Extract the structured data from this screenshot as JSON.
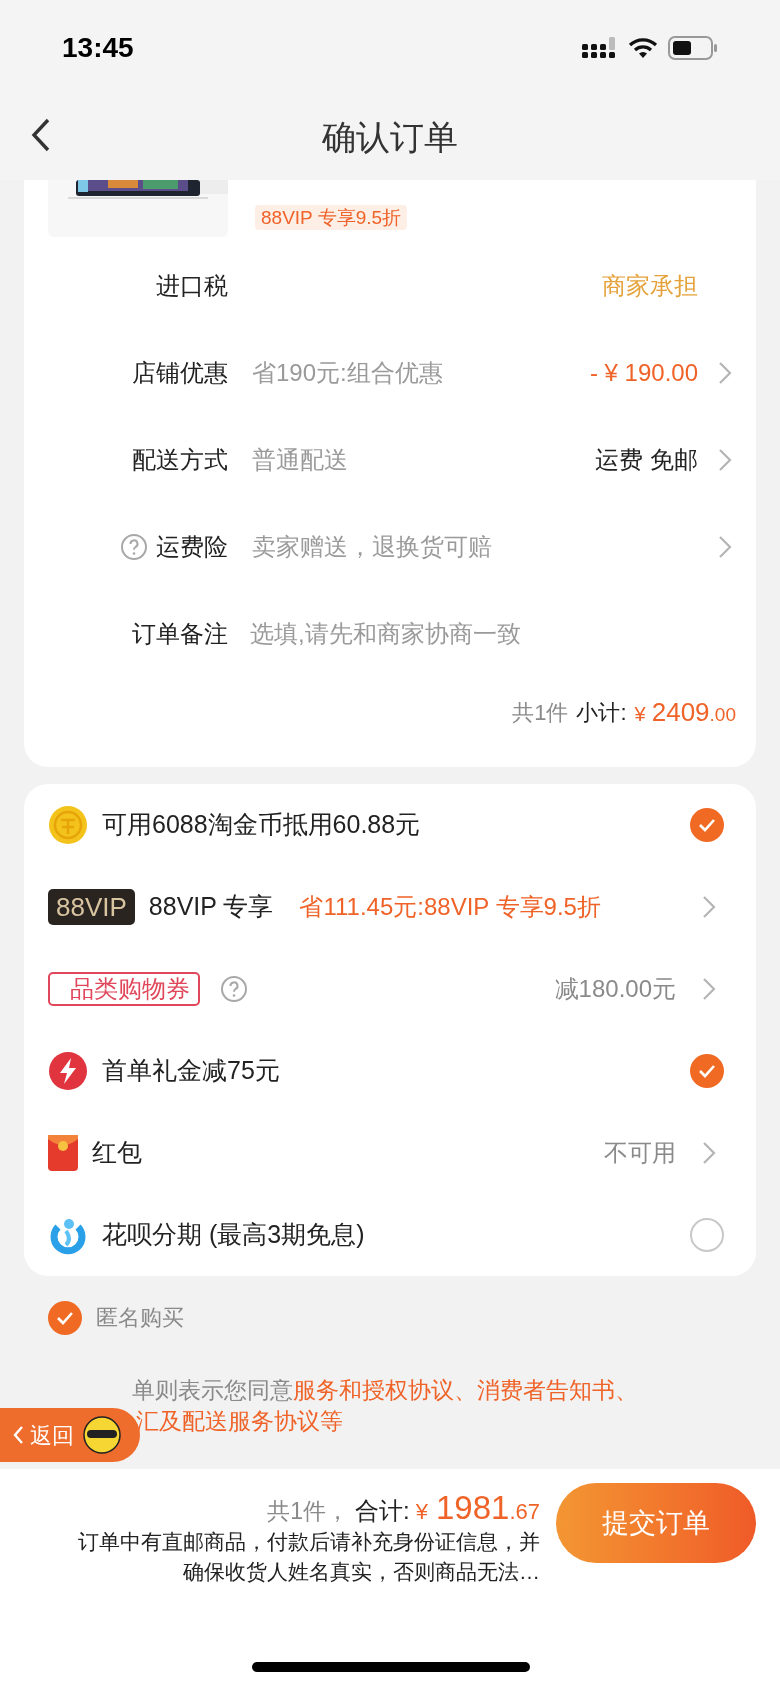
{
  "status_bar": {
    "time": "13:45"
  },
  "nav": {
    "title": "确认订单"
  },
  "product": {
    "tag": "88VIP 专享9.5折"
  },
  "order_rows": [
    {
      "label": "进口税",
      "help": false,
      "value": "商家承担",
      "color": "#e5a23b",
      "chevron": false
    },
    {
      "label": "店铺优惠",
      "help": false,
      "note": "省190元:组合优惠",
      "value": "- ¥ 190.00",
      "color": "#ef6328",
      "chevron": true
    },
    {
      "label": "配送方式",
      "help": false,
      "note": "普通配送",
      "value": "运费 免邮",
      "color": "#222222",
      "chevron": true
    },
    {
      "label": "运费险",
      "help": true,
      "note": "卖家赠送，退换货可赔",
      "chevron": true
    },
    {
      "label": "订单备注",
      "help": false,
      "placeholder": "选填,请先和商家协商一致",
      "chevron": false
    }
  ],
  "subtotal": {
    "count": "共1件",
    "label": "小计:",
    "currency": "¥",
    "amount": "2409",
    "decimals": ".00"
  },
  "benefits": [
    {
      "kind": "coin",
      "text": "可用6088淘金币抵用60.88元",
      "checked": true
    },
    {
      "kind": "vip",
      "badge": "88VIP",
      "text": "88VIP 专享",
      "detail": "省111.45元:88VIP 专享9.5折",
      "color": "#ef6328"
    },
    {
      "kind": "coupon",
      "tag": "品类购物券",
      "detail": "减180.00元",
      "color": "#8a8a8a"
    },
    {
      "kind": "gift",
      "text": "首单礼金减75元",
      "checked": true
    },
    {
      "kind": "redpacket",
      "text": "红包",
      "detail": "不可用",
      "color": "#8a8a8a"
    },
    {
      "kind": "huabei",
      "text": "花呗分期 (最高3期免息)",
      "checked": false
    }
  ],
  "anonymous": {
    "label": "匿名购买",
    "checked": true
  },
  "agreement": {
    "text": "单则表示您同意",
    "link_1": "服务和授权协议、消费者告知书、",
    "link_2": "汇及配送服务协议等"
  },
  "floating_back": {
    "label": "返回"
  },
  "bottom_bar": {
    "count": "共1件，",
    "label": "合计:",
    "currency": "¥",
    "amount": "1981",
    "decimals": ".67",
    "notice": "订单中有直邮商品，付款后请补充身份证信息，并确保收货人姓名真实，否则商品无法…",
    "submit": "提交订单"
  }
}
